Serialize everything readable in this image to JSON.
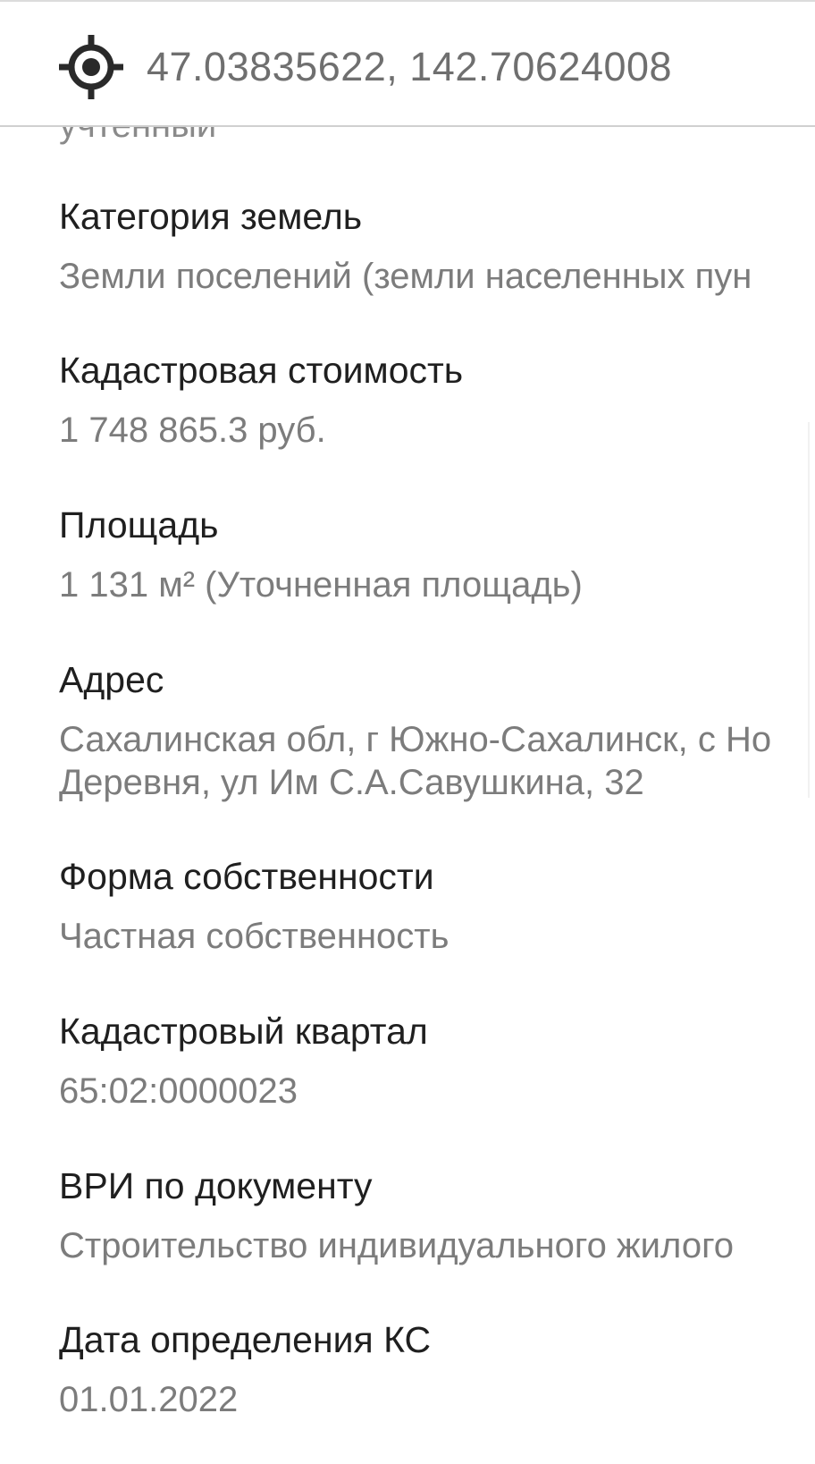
{
  "header": {
    "coordinates": "47.03835622, 142.70624008"
  },
  "truncated_top_value": "учтенный",
  "fields": [
    {
      "label": "Категория земель",
      "value": "Земли поселений (земли населенных пун"
    },
    {
      "label": "Кадастровая стоимость",
      "value": "1 748 865.3 руб."
    },
    {
      "label": "Площадь",
      "value": "1 131 м² (Уточненная площадь)"
    },
    {
      "label": "Адрес",
      "value_line1": "Сахалинская обл, г Южно-Сахалинск, с Но",
      "value_line2": "Деревня, ул Им С.А.Савушкина, 32"
    },
    {
      "label": "Форма собственности",
      "value": "Частная собственность"
    },
    {
      "label": "Кадастровый квартал",
      "value": "65:02:0000023"
    },
    {
      "label": "ВРИ по документу",
      "value": "Строительство индивидуального жилого"
    },
    {
      "label": "Дата определения КС",
      "value": "01.01.2022"
    }
  ],
  "icons": {
    "location": "gps-target-icon"
  }
}
